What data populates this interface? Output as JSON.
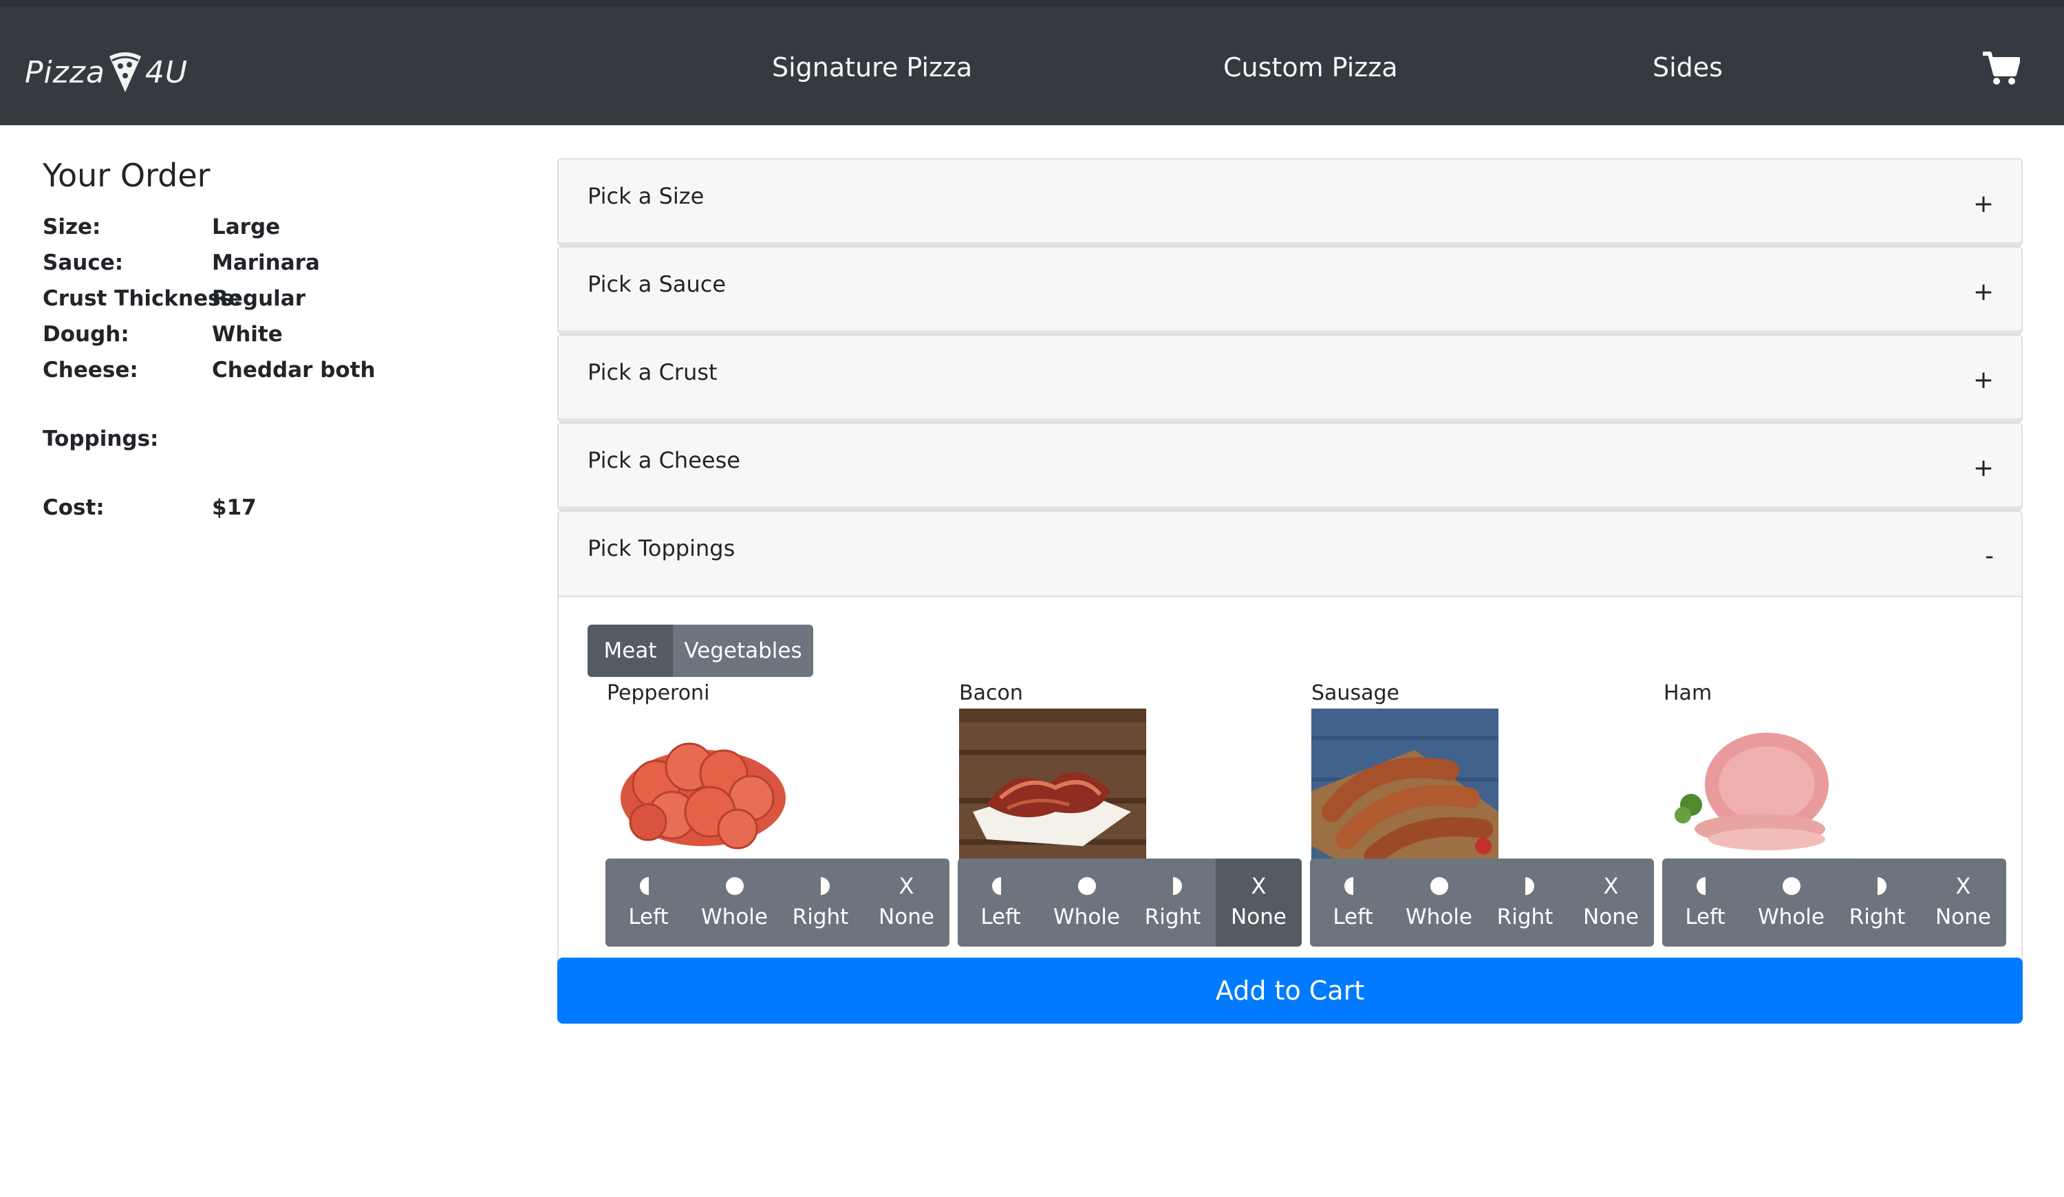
{
  "brand": {
    "logo_text_left": "Pizza",
    "logo_text_right": "4U"
  },
  "nav": {
    "links": [
      "Signature Pizza",
      "Custom Pizza",
      "Sides"
    ],
    "cart_icon": "shopping-cart-icon"
  },
  "order": {
    "title": "Your Order",
    "rows": [
      {
        "label": "Size:",
        "value": "Large"
      },
      {
        "label": "Sauce:",
        "value": "Marinara"
      },
      {
        "label": "Crust Thickness:",
        "value": "Regular"
      },
      {
        "label": "Dough:",
        "value": "White"
      },
      {
        "label": "Cheese:",
        "value": "Cheddar both"
      }
    ],
    "toppings_label": "Toppings:",
    "cost_label": "Cost:",
    "cost_value": "$17"
  },
  "accordion": {
    "sections": [
      {
        "label": "Pick a Size",
        "sign": "+"
      },
      {
        "label": "Pick a Sauce",
        "sign": "+"
      },
      {
        "label": "Pick a Crust",
        "sign": "+"
      },
      {
        "label": "Pick a Cheese",
        "sign": "+"
      },
      {
        "label": "Pick Toppings",
        "sign": "-"
      }
    ]
  },
  "toppings": {
    "tabs": [
      "Meat",
      "Vegetables"
    ],
    "active_tab": "Meat",
    "items": [
      {
        "name": "Pepperoni",
        "selected": ""
      },
      {
        "name": "Bacon",
        "selected": "None"
      },
      {
        "name": "Sausage",
        "selected": ""
      },
      {
        "name": "Ham",
        "selected": ""
      }
    ],
    "options": [
      "Left",
      "Whole",
      "Right",
      "None"
    ],
    "none_glyph": "X"
  },
  "actions": {
    "add_to_cart": "Add to Cart"
  },
  "colors": {
    "navbar": "#343a40",
    "primary": "#007bff",
    "btn_secondary": "#6c757d",
    "btn_active": "#545b62"
  }
}
